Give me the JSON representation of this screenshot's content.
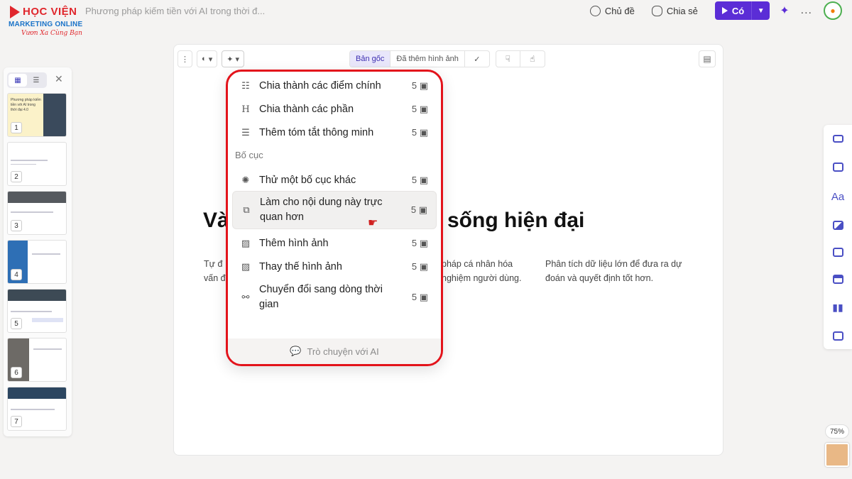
{
  "header": {
    "logo": {
      "line1": "HỌC VIỆN",
      "line2": "MARKETING ONLINE",
      "line3": "Vươn Xa Cùng Bạn"
    },
    "doc_title": "Phương pháp kiếm tiền với AI trong thời đ...",
    "theme_label": "Chủ đề",
    "share_label": "Chia sẻ",
    "present_label": "Có",
    "more_label": "...",
    "sparkle_icon": "✦",
    "colors": {
      "accent": "#5b2dd6"
    }
  },
  "sidebar": {
    "slides": [
      "1",
      "2",
      "3",
      "4",
      "5",
      "6",
      "7"
    ],
    "thumb1_title": "Phương pháp kiếm tiền với AI trong thời đại 4.0"
  },
  "toolbar": {
    "original_label": "Bản gốc",
    "images_added_label": "Đã thêm hình ảnh"
  },
  "slide": {
    "heading_left": "Và",
    "heading_right": "sống hiện đại",
    "col1_line1": "Tự đ",
    "col1_line2": "vấn đ",
    "col2_line1": "pháp cá nhân hóa",
    "col2_line2": "nghiệm người dùng.",
    "col3_line1": "Phân tích dữ liệu lớn để đưa ra dự",
    "col3_line2": "đoán và quyết định tốt hơn."
  },
  "menu": {
    "items_top": [
      {
        "icon": "list-bullets-icon",
        "label": "Chia thành các điểm chính",
        "count": "5"
      },
      {
        "icon": "heading-icon",
        "label": "Chia thành các phần",
        "count": "5"
      },
      {
        "icon": "summary-icon",
        "label": "Thêm tóm tắt thông minh",
        "count": "5"
      }
    ],
    "section_label": "Bố cục",
    "items_layout": [
      {
        "icon": "lightbulb-icon",
        "label": "Thử một bố cục khác",
        "count": "5"
      },
      {
        "icon": "visual-icon",
        "label": "Làm cho nội dung này trực quan hơn",
        "count": "5"
      },
      {
        "icon": "image-add-icon",
        "label": "Thêm hình ảnh",
        "count": "5"
      },
      {
        "icon": "image-replace-icon",
        "label": "Thay thế hình ảnh",
        "count": "5"
      },
      {
        "icon": "timeline-icon",
        "label": "Chuyển đổi sang dòng thời gian",
        "count": "5"
      }
    ],
    "chat_label": "Trò chuyện với AI"
  },
  "zoom": "75%"
}
